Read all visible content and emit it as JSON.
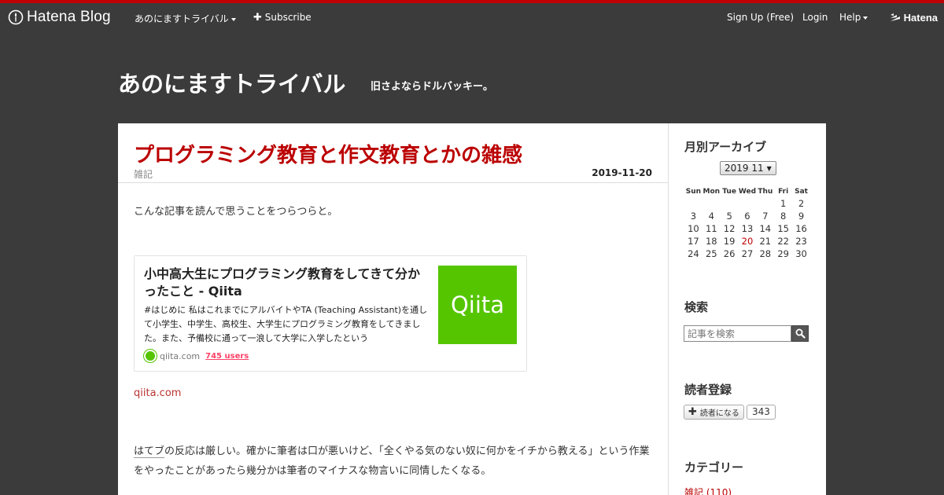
{
  "global_header": {
    "logo_text": "Hatena Blog",
    "blog_menu_label": "あのにますトライバル",
    "subscribe_label": "Subscribe",
    "signup_label": "Sign Up (Free)",
    "login_label": "Login",
    "help_label": "Help",
    "hatena_label": "Hatena"
  },
  "blog": {
    "title": "あのにますトライバル",
    "description": "旧さよならドルバッキー。"
  },
  "entry": {
    "title": "プログラミング教育と作文教育とかの雑感",
    "category": "雑記",
    "date": "2019-11-20",
    "paragraph1": "こんな記事を読んで思うことをつらつらと。",
    "card": {
      "title": "小中高大生にプログラミング教育をしてきて分かったこと - Qiita",
      "description": "#はじめに 私はこれまでにアルバイトやTA (Teaching Assistant)を通して小学生、中学生、高校生、大学生にプログラミング教育をしてきました。また、予備校に通って一浪して大学に入学したという",
      "thumb_text": "Qiita",
      "domain": "qiita.com",
      "users": "745 users"
    },
    "link_text": "qiita.com",
    "paragraph2_keyword": "はてブ",
    "paragraph2_rest": "の反応は厳しい。確かに筆者は口が悪いけど、「全くやる気のない奴に何かをイチから教える」という作業をやったことがあったら幾分かは筆者のマイナスな物言いに同情したくなる。"
  },
  "sidebar": {
    "archive_title": "月別アーカイブ",
    "month_select": "2019 11",
    "weekdays": [
      "Sun",
      "Mon",
      "Tue",
      "Wed",
      "Thu",
      "Fri",
      "Sat"
    ],
    "weeks": [
      [
        "",
        "",
        "",
        "",
        "",
        "1",
        "2"
      ],
      [
        "3",
        "4",
        "5",
        "6",
        "7",
        "8",
        "9"
      ],
      [
        "10",
        "11",
        "12",
        "13",
        "14",
        "15",
        "16"
      ],
      [
        "17",
        "18",
        "19",
        "20",
        "21",
        "22",
        "23"
      ],
      [
        "24",
        "25",
        "26",
        "27",
        "28",
        "29",
        "30"
      ]
    ],
    "linked_day": "20",
    "search_title": "検索",
    "search_placeholder": "記事を検索",
    "subscribe_title": "読者登録",
    "subscribe_button": "読者になる",
    "subscriber_count": "343",
    "category_title": "カテゴリー",
    "category_item": "雑記 (110)"
  },
  "colors": {
    "header_red": "#c00000",
    "title_red": "#bb0000",
    "qiita_green": "#55c500",
    "background": "#3b3b3b"
  }
}
